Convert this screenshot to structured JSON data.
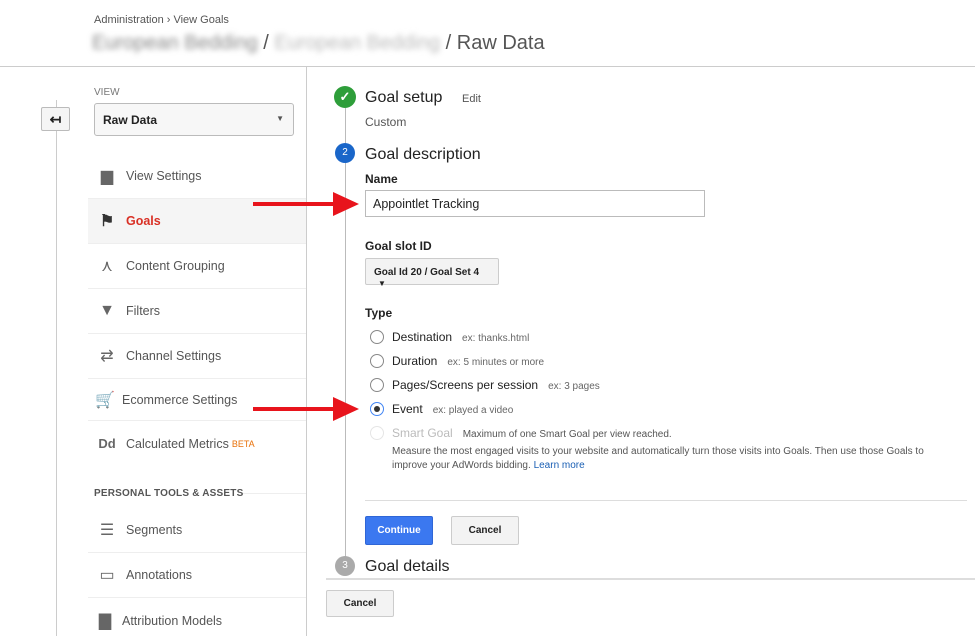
{
  "header": {
    "breadcrumb": "Administration › View Goals",
    "account": "European Bedding",
    "property": "European Bedding",
    "view_title": "/ Raw Data",
    "sep": "/"
  },
  "sidebar": {
    "view_label": "VIEW",
    "view_value": "Raw Data",
    "items": [
      {
        "label": "View Settings",
        "icon": "document-icon"
      },
      {
        "label": "Goals",
        "icon": "flag-icon",
        "active": true
      },
      {
        "label": "Content Grouping",
        "icon": "merge-icon"
      },
      {
        "label": "Filters",
        "icon": "filter-icon"
      },
      {
        "label": "Channel Settings",
        "icon": "channel-icon"
      },
      {
        "label": "Ecommerce Settings",
        "icon": "cart-icon"
      },
      {
        "label": "Calculated Metrics",
        "icon": "dd-icon",
        "badge": "BETA"
      }
    ],
    "section_title": "PERSONAL TOOLS & ASSETS",
    "tools": [
      {
        "label": "Segments",
        "icon": "segments-icon"
      },
      {
        "label": "Annotations",
        "icon": "annotation-icon"
      },
      {
        "label": "Attribution Models",
        "icon": "bar-chart-icon"
      }
    ]
  },
  "goal": {
    "step1": {
      "title": "Goal setup",
      "edit": "Edit",
      "value": "Custom",
      "num": "✓"
    },
    "step2": {
      "num": "2",
      "title": "Goal description",
      "name_label": "Name",
      "name_value": "Appointlet Tracking",
      "slot_label": "Goal slot ID",
      "slot_value": "Goal Id 20 / Goal Set 4",
      "type_label": "Type",
      "types": [
        {
          "label": "Destination",
          "ex": "ex: thanks.html",
          "selected": false
        },
        {
          "label": "Duration",
          "ex": "ex: 5 minutes or more",
          "selected": false
        },
        {
          "label": "Pages/Screens per session",
          "ex": "ex: 3 pages",
          "selected": false
        },
        {
          "label": "Event",
          "ex": "ex: played a video",
          "selected": true
        },
        {
          "label": "Smart Goal",
          "ex": "Maximum of one Smart Goal per view reached.",
          "disabled": true
        }
      ],
      "smart_desc": "Measure the most engaged visits to your website and automatically turn those visits into Goals. Then use those Goals to improve your AdWords bidding.",
      "learn_more": "Learn more",
      "continue": "Continue",
      "cancel": "Cancel"
    },
    "step3": {
      "num": "3",
      "title": "Goal details"
    },
    "cancel": "Cancel"
  },
  "colors": {
    "accent": "#3b78f0",
    "active": "#d93025",
    "success": "#2e9e3a",
    "annotation_arrow": "#e8141c"
  }
}
